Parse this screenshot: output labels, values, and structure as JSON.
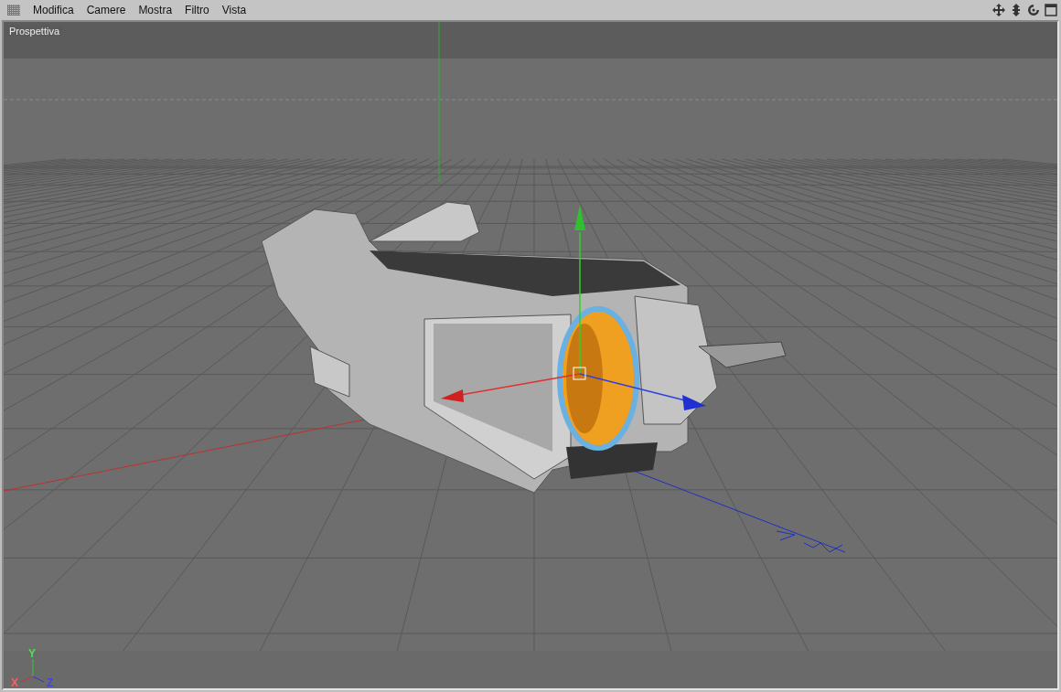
{
  "menu": {
    "items": [
      {
        "label": "Modifica"
      },
      {
        "label": "Camere"
      },
      {
        "label": "Mostra"
      },
      {
        "label": "Filtro"
      },
      {
        "label": "Vista"
      }
    ]
  },
  "viewport": {
    "label": "Prospettiva",
    "axis_labels": {
      "y": "Y",
      "x": "X",
      "z": "Z"
    }
  }
}
